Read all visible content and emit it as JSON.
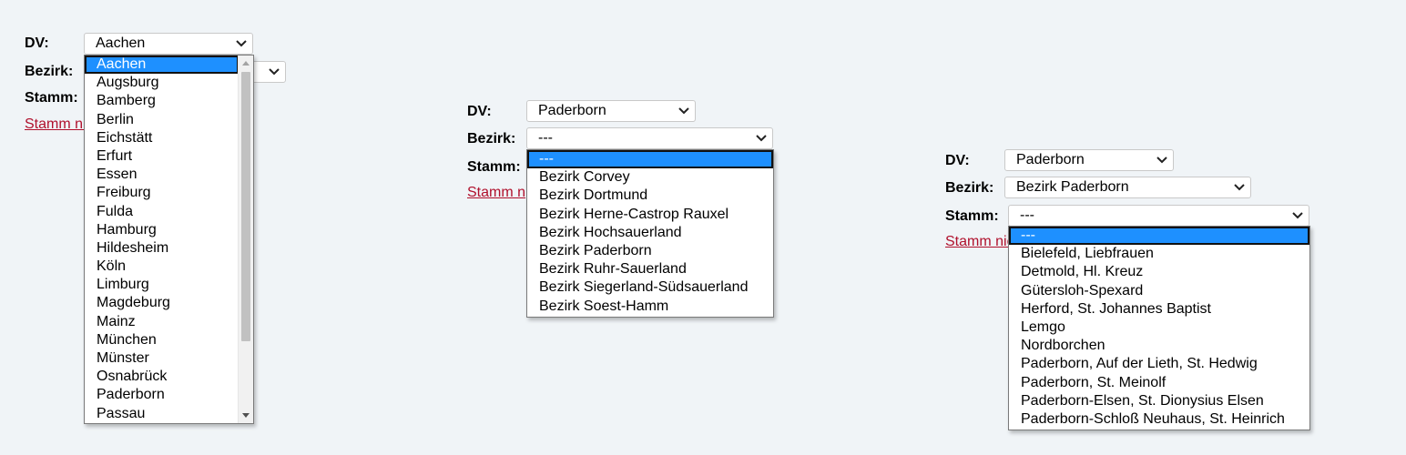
{
  "labels": {
    "dv": "DV:",
    "bezirk": "Bezirk:",
    "stamm": "Stamm:"
  },
  "link_text": "Stamm nicht gefunden?",
  "panel1": {
    "dv_value": "Aachen",
    "dv_options": [
      "Aachen",
      "Augsburg",
      "Bamberg",
      "Berlin",
      "Eichstätt",
      "Erfurt",
      "Essen",
      "Freiburg",
      "Fulda",
      "Hamburg",
      "Hildesheim",
      "Köln",
      "Limburg",
      "Magdeburg",
      "Mainz",
      "München",
      "Münster",
      "Osnabrück",
      "Paderborn",
      "Passau"
    ]
  },
  "panel2": {
    "dv_value": "Paderborn",
    "bezirk_value": "---",
    "bezirk_options": [
      "---",
      "Bezirk Corvey",
      "Bezirk Dortmund",
      "Bezirk Herne-Castrop Rauxel",
      "Bezirk Hochsauerland",
      "Bezirk Paderborn",
      "Bezirk Ruhr-Sauerland",
      "Bezirk Siegerland-Südsauerland",
      "Bezirk Soest-Hamm"
    ]
  },
  "panel3": {
    "dv_value": "Paderborn",
    "bezirk_value": "Bezirk Paderborn",
    "stamm_value": "---",
    "stamm_options": [
      "---",
      "Bielefeld, Liebfrauen",
      "Detmold, Hl. Kreuz",
      "Gütersloh-Spexard",
      "Herford, St. Johannes Baptist",
      "Lemgo",
      "Nordborchen",
      "Paderborn, Auf der Lieth, St. Hedwig",
      "Paderborn, St. Meinolf",
      "Paderborn-Elsen, St. Dionysius Elsen",
      "Paderborn-Schloß Neuhaus, St. Heinrich"
    ]
  }
}
